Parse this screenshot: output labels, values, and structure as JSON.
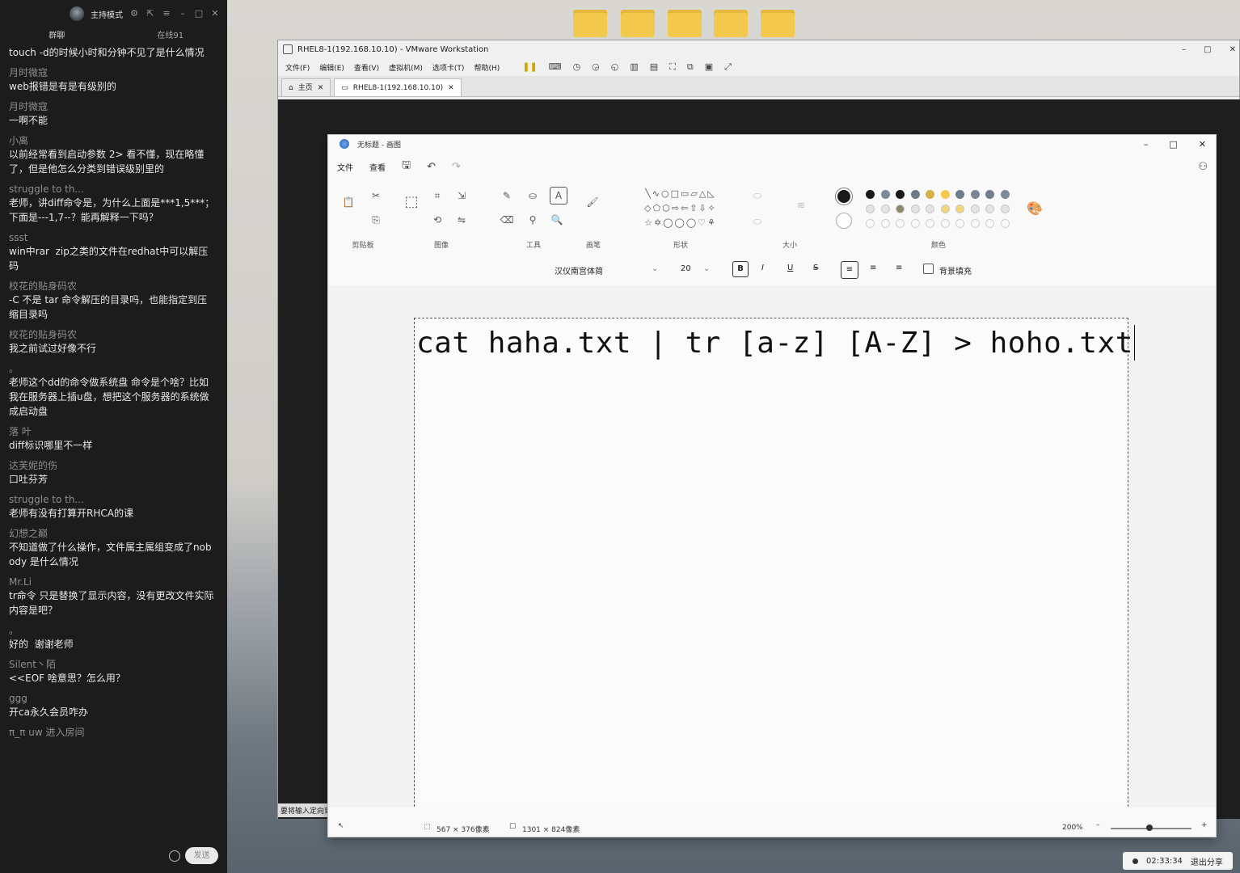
{
  "chat": {
    "top_label": "主持模式",
    "tabs": [
      {
        "label": "群聊"
      },
      {
        "label": "在线91"
      }
    ],
    "messages": [
      {
        "name": "",
        "text": "touch -d的时候小时和分钟不见了是什么情况"
      },
      {
        "name": "月时微寇",
        "text": "web报错是有是有级别的"
      },
      {
        "name": "月时微寇",
        "text": "一啊不能"
      },
      {
        "name": "小离",
        "text": "以前经常看到启动参数 2> 看不懂，现在略懂了，但是他怎么分类到错误级别里的"
      },
      {
        "name": "struggle to th...",
        "text": "老师，讲diff命令是，为什么上面是***1,5***；下面是---1,7--？能再解释一下吗？"
      },
      {
        "name": "ssst",
        "text": "win中rar  zip之类的文件在redhat中可以解压码"
      },
      {
        "name": "校花的贴身码农",
        "text": "-C 不是 tar 命令解压的目录吗，也能指定到压缩目录吗"
      },
      {
        "name": "校花的贴身码农",
        "text": "我之前试过好像不行"
      },
      {
        "name": "。",
        "text": "老师这个dd的命令做系统盘 命令是个啥？比如我在服务器上插u盘，想把这个服务器的系统做成启动盘"
      },
      {
        "name": "落  叶",
        "text": "diff标识哪里不一样"
      },
      {
        "name": "达芙妮的伤",
        "text": "口吐芬芳"
      },
      {
        "name": "struggle to th...",
        "text": "老师有没有打算开RHCA的课"
      },
      {
        "name": "幻想之巅",
        "text": "不知道做了什么操作，文件属主属组变成了nobody 是什么情况"
      },
      {
        "name": "Mr.Li",
        "text": "tr命令 只是替换了显示内容，没有更改文件实际内容是吧？"
      },
      {
        "name": "。",
        "text": "好的  谢谢老师"
      },
      {
        "name": "Silent丶陌",
        "text": "<<EOF 啥意思？怎么用？"
      },
      {
        "name": "ggg",
        "text": "开ca永久会员咋办"
      },
      {
        "name": "π_π uw 进入房间",
        "text": ""
      }
    ],
    "send_label": "发送"
  },
  "vmware": {
    "title": "RHEL8-1(192.168.10.10) - VMware Workstation",
    "menu": [
      "文件(F)",
      "编辑(E)",
      "查看(V)",
      "虚拟机(M)",
      "选项卡(T)",
      "帮助(H)"
    ],
    "tabs": [
      {
        "label": "主页"
      },
      {
        "label": "RHEL8-1(192.168.10.10)"
      }
    ],
    "status_hint": "要将输入定向到"
  },
  "paint": {
    "title": "无标题 - 画图",
    "menu": [
      "文件",
      "查看"
    ],
    "groups": {
      "clipboard": "剪贴板",
      "image": "图像",
      "tools": "工具",
      "brush": "画笔",
      "shapes": "形状",
      "size": "大小",
      "colors": "颜色"
    },
    "font_name": "汉仪南宫体简",
    "font_size": "20",
    "fill_background": "背景填充",
    "canvas_text": "cat haha.txt | tr [a-z] [A-Z] > hoho.txt",
    "status": {
      "selection": "567 × 376像素",
      "canvas_size": "1301 × 824像素",
      "zoom": "200%"
    },
    "palette": [
      "#1a1a1a",
      "#7d8a9a",
      "#1a1a1a",
      "#707a86",
      "#d4b24a",
      "#f2c94c",
      "#6e7c8c",
      "#7a8696",
      "#6f7d8d",
      "#7d8a9a"
    ]
  },
  "share": {
    "time": "02:33:34",
    "label": "退出分享"
  }
}
